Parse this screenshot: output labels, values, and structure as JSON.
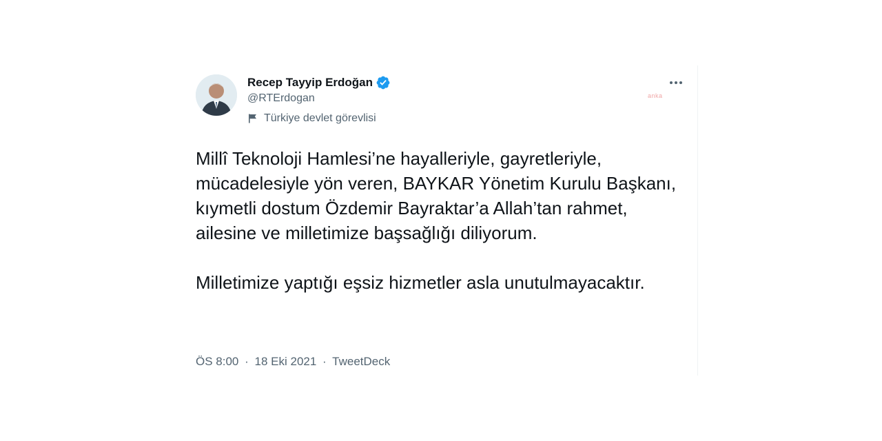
{
  "tweet": {
    "author": {
      "display_name": "Recep Tayyip Erdoğan",
      "handle": "@RTErdogan",
      "verified_icon": "verified-badge-icon",
      "label": "Türkiye devlet görevlisi",
      "label_icon": "flag-icon"
    },
    "more_icon": "more-dots-icon",
    "watermark": "anka",
    "body_paragraphs": [
      "Millî Teknoloji Hamlesi’ne hayalleriyle, gayretleriyle, mücadelesiyle yön veren, BAYKAR Yönetim Kurulu Başkanı, kıymetli dostum Özdemir Bayraktar’a Allah’tan rahmet, ailesine ve milletimize başsağlığı diliyorum.",
      "Milletimize yaptığı eşsiz hizmetler asla unutulmayacaktır."
    ],
    "meta": {
      "time": "ÖS 8:00",
      "separator": "·",
      "date": "18 Eki 2021",
      "source": "TweetDeck"
    }
  },
  "colors": {
    "verified": "#1d9bf0",
    "secondary_text": "#536471",
    "primary_text": "#0f1419",
    "watermark": "#f0a6a6"
  }
}
